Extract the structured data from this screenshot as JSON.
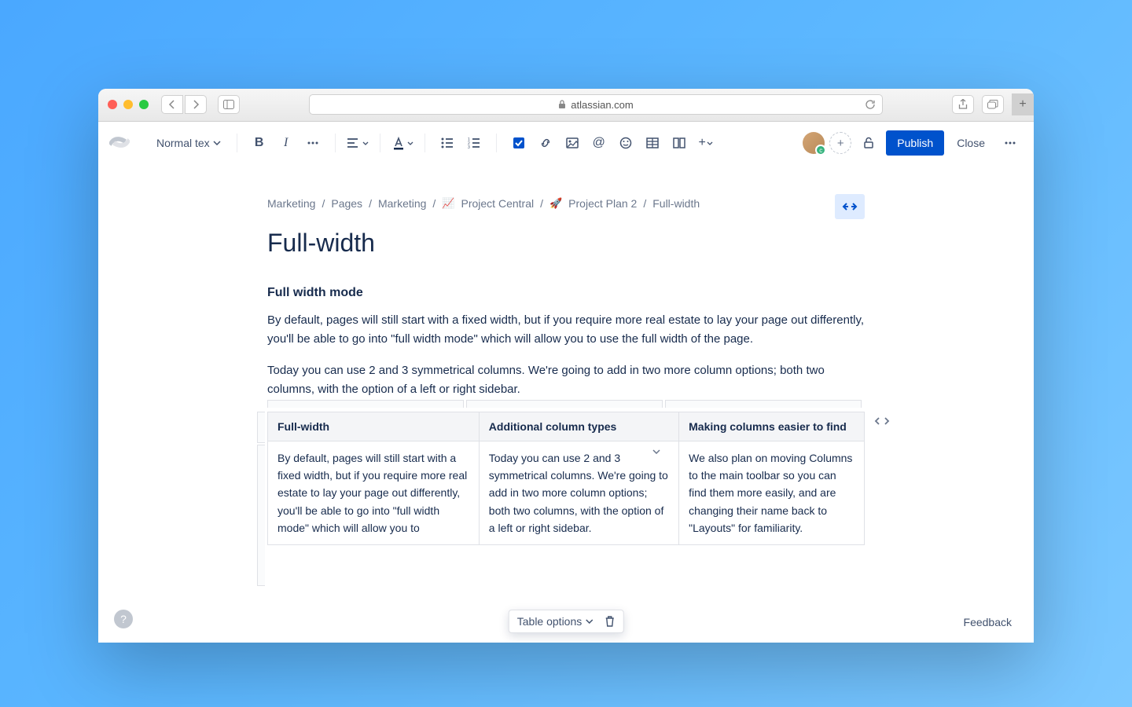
{
  "browser": {
    "url_host": "atlassian.com"
  },
  "toolbar": {
    "text_style": "Normal tex",
    "publish": "Publish",
    "close": "Close"
  },
  "breadcrumb": {
    "items": [
      "Marketing",
      "Pages",
      "Marketing",
      "Project Central",
      "Project Plan 2",
      "Full-width"
    ],
    "icon_project_central": "📈",
    "icon_project_plan": "🚀"
  },
  "page": {
    "title": "Full-width",
    "section_heading": "Full width mode",
    "para1": "By default, pages will still start with a fixed width, but if you require more real estate to lay your page out differently, you'll be able to go into \"full width mode\" which will allow you to use the full width of the page.",
    "para2": "Today you can use 2 and 3 symmetrical columns. We're going to add in two more column options; both two columns, with the option of a left or right sidebar."
  },
  "table": {
    "headers": [
      "Full-width",
      "Additional column types",
      "Making columns easier to find"
    ],
    "cells": [
      "By default, pages will still start with a fixed width, but if you require more real estate to lay your page out differently, you'll be able to go into \"full width mode\" which will allow you to",
      "Today you can use 2 and 3 symmetrical columns. We're going to add in two more column options; both two columns, with the option of a left or right sidebar.",
      "We also plan on moving Columns to the main toolbar so you can find them more easily, and are changing their name back to \"Layouts\" for familiarity."
    ],
    "options_label": "Table options"
  },
  "footer": {
    "feedback": "Feedback"
  }
}
